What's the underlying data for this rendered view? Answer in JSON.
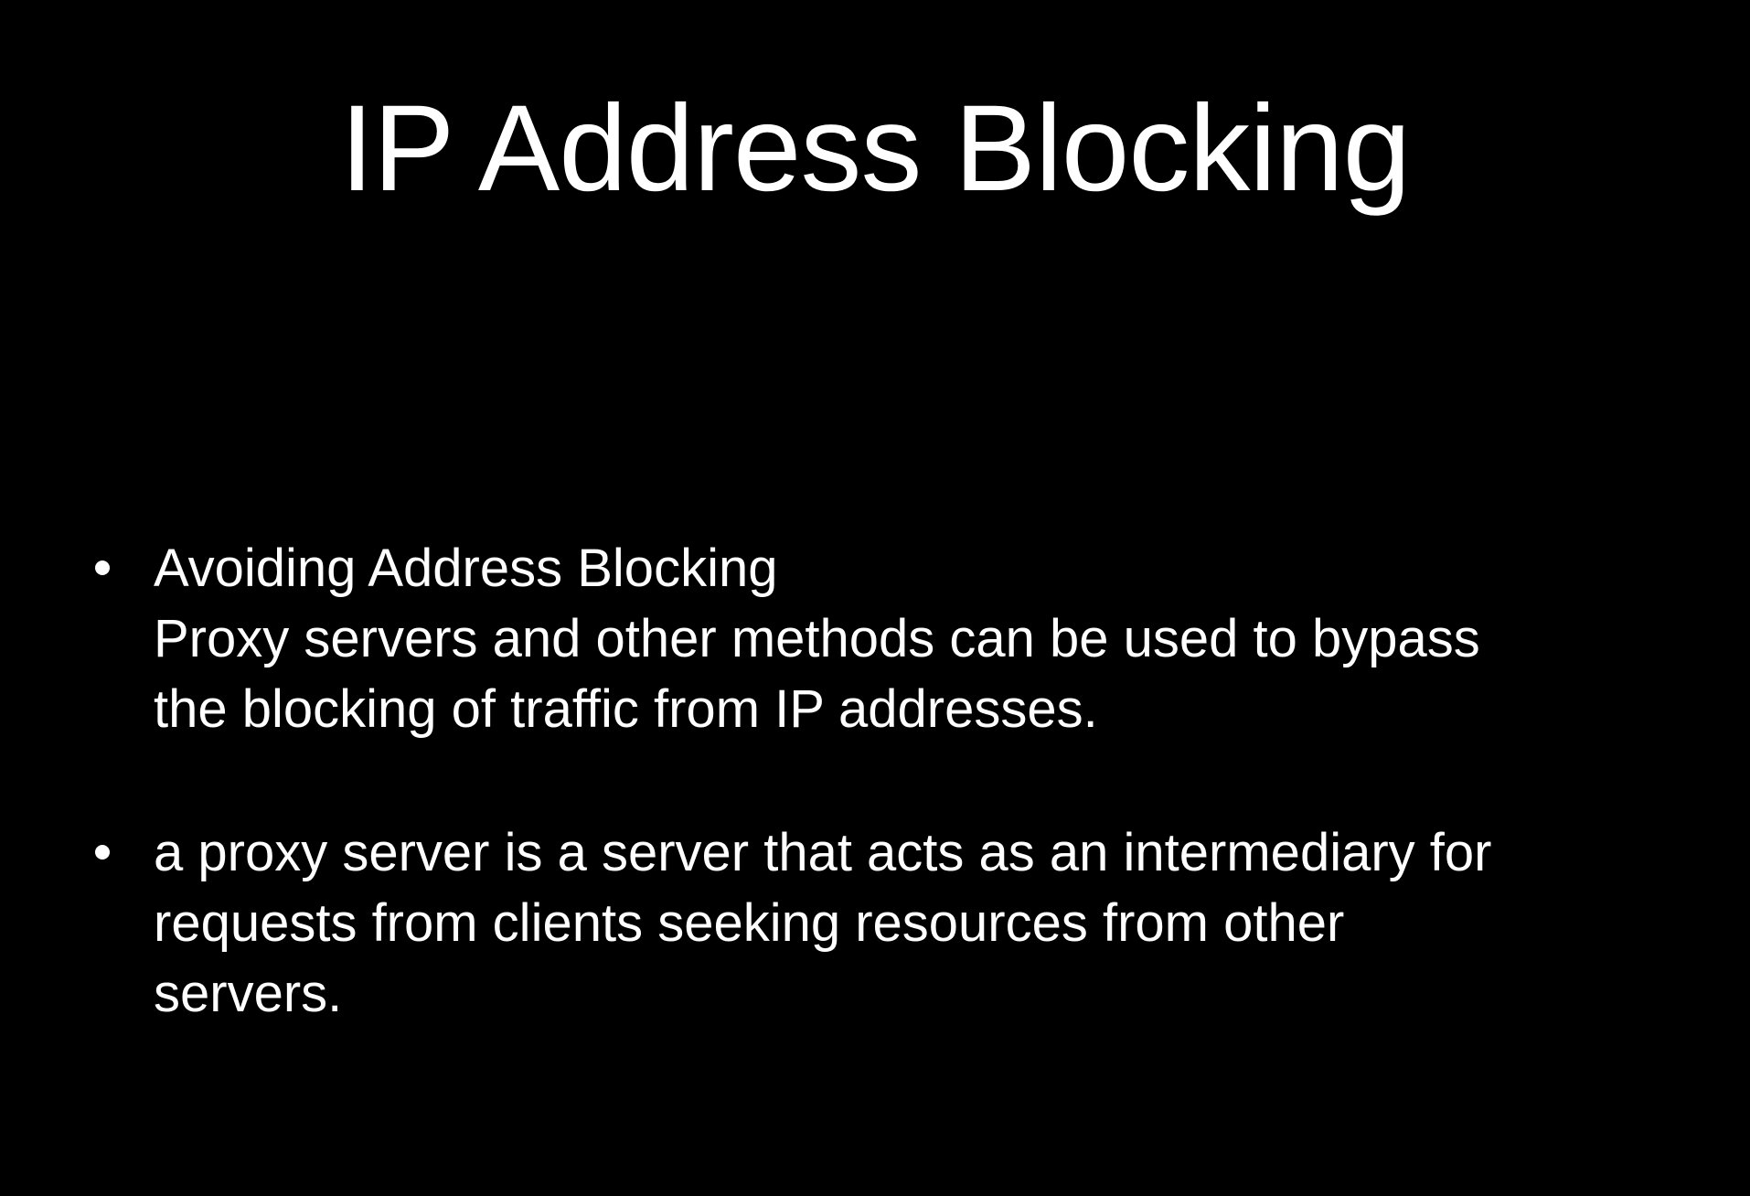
{
  "slide": {
    "title": "IP Address Blocking",
    "bullets": [
      {
        "lines": [
          "Avoiding Address Blocking",
          "Proxy servers and other methods can be used to bypass",
          "the blocking of traffic from IP addresses."
        ]
      },
      {
        "lines": [
          "a proxy server is a server that acts as an intermediary for",
          "requests from clients seeking resources from other",
          "servers."
        ]
      }
    ]
  },
  "colors": {
    "background": "#000000",
    "text": "#ffffff"
  }
}
